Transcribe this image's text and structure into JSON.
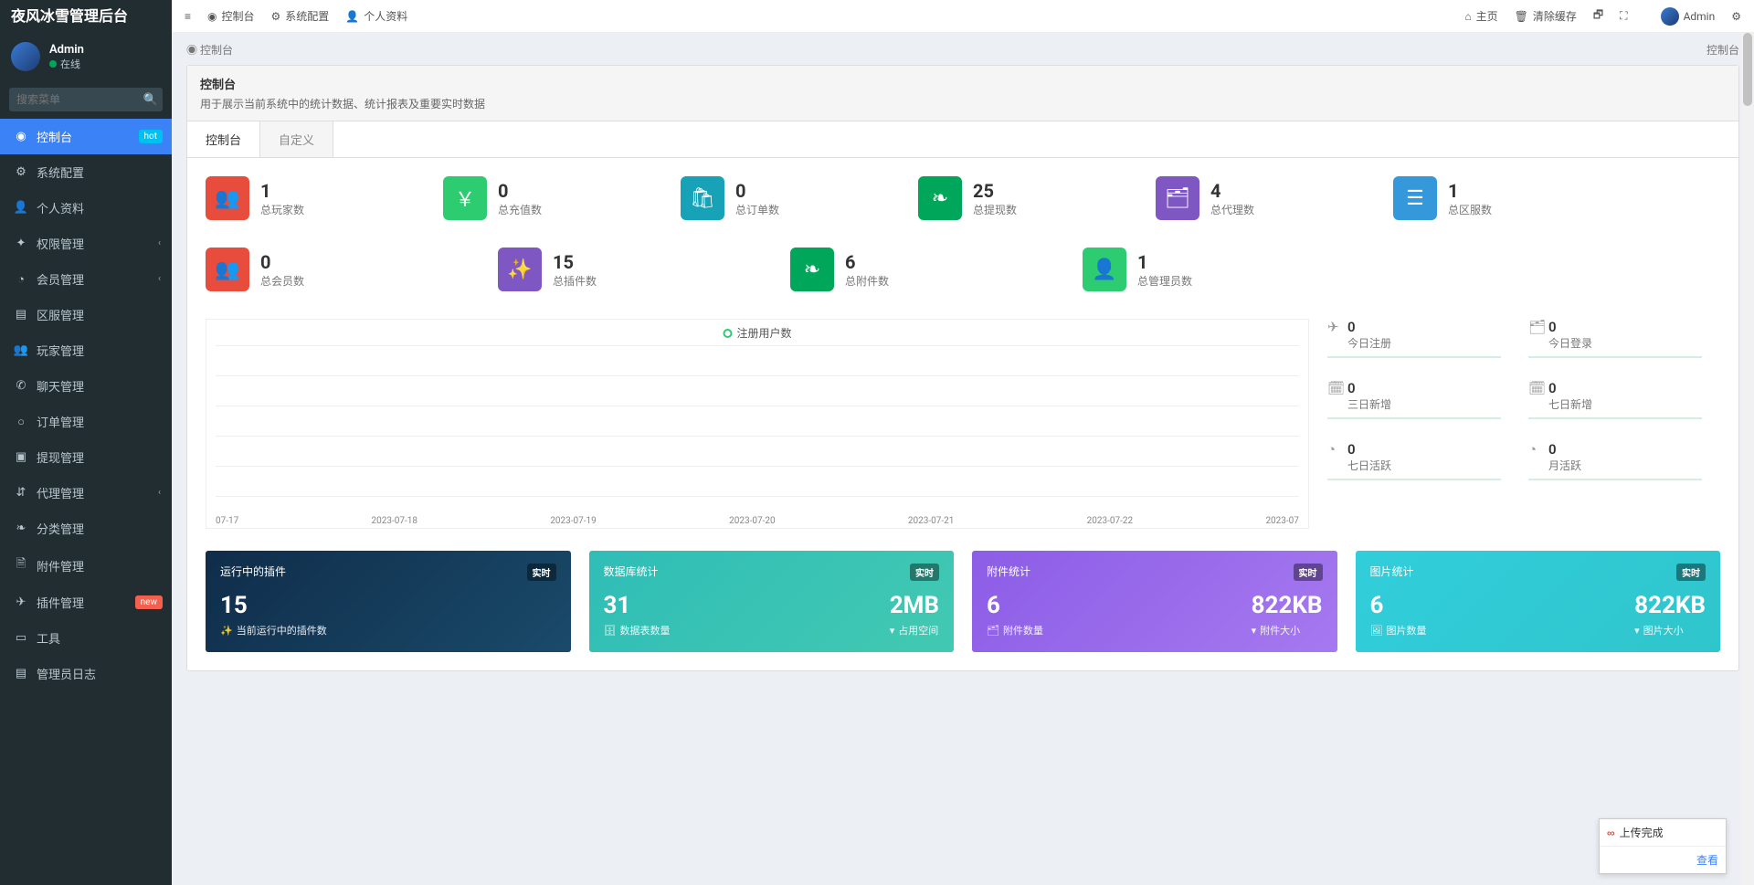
{
  "brand": "夜风冰雪管理后台",
  "user": {
    "name": "Admin",
    "status": "在线"
  },
  "search_placeholder": "搜索菜单",
  "sidebar": {
    "items": [
      {
        "label": "控制台",
        "icon": "◉",
        "badge": "hot",
        "active": true
      },
      {
        "label": "系统配置",
        "icon": "⚙"
      },
      {
        "label": "个人资料",
        "icon": "👤"
      },
      {
        "label": "权限管理",
        "icon": "✦",
        "chev": true
      },
      {
        "label": "会员管理",
        "icon": "◔",
        "chev": true
      },
      {
        "label": "区服管理",
        "icon": "▤"
      },
      {
        "label": "玩家管理",
        "icon": "👥"
      },
      {
        "label": "聊天管理",
        "icon": "✆"
      },
      {
        "label": "订单管理",
        "icon": "○"
      },
      {
        "label": "提现管理",
        "icon": "▣"
      },
      {
        "label": "代理管理",
        "icon": "⇵",
        "chev": true
      },
      {
        "label": "分类管理",
        "icon": "❧"
      },
      {
        "label": "附件管理",
        "icon": "🗎"
      },
      {
        "label": "插件管理",
        "icon": "✈",
        "badge": "new"
      },
      {
        "label": "工具",
        "icon": "▭"
      },
      {
        "label": "管理员日志",
        "icon": "▤"
      }
    ]
  },
  "topnav": {
    "left": [
      {
        "label": "控制台",
        "icon": "◉"
      },
      {
        "label": "系统配置",
        "icon": "⚙"
      },
      {
        "label": "个人资料",
        "icon": "👤"
      }
    ],
    "right": [
      {
        "label": "主页",
        "icon": "⌂"
      },
      {
        "label": "清除缓存",
        "icon": "🗑"
      },
      {
        "label": "",
        "icon": "🗗"
      },
      {
        "label": "",
        "icon": "⛶"
      }
    ],
    "user": "Admin",
    "gear": "⚙"
  },
  "breadcrumb": {
    "left": "控制台",
    "right": "控制台",
    "icon": "◉"
  },
  "panel": {
    "title": "控制台",
    "subtitle": "用于展示当前系统中的统计数据、统计报表及重要实时数据",
    "tabs": [
      "控制台",
      "自定义"
    ]
  },
  "stats1": [
    {
      "value": "1",
      "label": "总玩家数",
      "icon": "👥",
      "color": "bg-red"
    },
    {
      "value": "0",
      "label": "总充值数",
      "icon": "￥",
      "color": "bg-green"
    },
    {
      "value": "0",
      "label": "总订单数",
      "icon": "🛍",
      "color": "bg-teal"
    },
    {
      "value": "25",
      "label": "总提现数",
      "icon": "❧",
      "color": "bg-leaf"
    },
    {
      "value": "4",
      "label": "总代理数",
      "icon": "🗂",
      "color": "bg-purple"
    },
    {
      "value": "1",
      "label": "总区服数",
      "icon": "☰",
      "color": "bg-navy"
    }
  ],
  "stats2": [
    {
      "value": "0",
      "label": "总会员数",
      "icon": "👥",
      "color": "bg-red"
    },
    {
      "value": "15",
      "label": "总插件数",
      "icon": "✨",
      "color": "bg-purple"
    },
    {
      "value": "6",
      "label": "总附件数",
      "icon": "❧",
      "color": "bg-leaf"
    },
    {
      "value": "1",
      "label": "总管理员数",
      "icon": "👤",
      "color": "bg-green"
    }
  ],
  "chart": {
    "legend": "注册用户数",
    "x": [
      "07-17",
      "2023-07-18",
      "2023-07-19",
      "2023-07-20",
      "2023-07-21",
      "2023-07-22",
      "2023-07"
    ]
  },
  "side_metrics": [
    {
      "value": "0",
      "label": "今日注册",
      "icon": "✈"
    },
    {
      "value": "0",
      "label": "今日登录",
      "icon": "🗂"
    },
    {
      "value": "0",
      "label": "三日新增",
      "icon": "🗓"
    },
    {
      "value": "0",
      "label": "七日新增",
      "icon": "🗓"
    },
    {
      "value": "0",
      "label": "七日活跃",
      "icon": "◔"
    },
    {
      "value": "0",
      "label": "月活跃",
      "icon": "◔"
    }
  ],
  "cards": [
    {
      "title": "运行中的插件",
      "badge": "实时",
      "v1": "15",
      "l1": "当前运行中的插件数",
      "i1": "✨",
      "single": true
    },
    {
      "title": "数据库统计",
      "badge": "实时",
      "v1": "31",
      "l1": "数据表数量",
      "i1": "🗄",
      "v2": "2MB",
      "l2": "占用空间",
      "i2": "▾"
    },
    {
      "title": "附件统计",
      "badge": "实时",
      "v1": "6",
      "l1": "附件数量",
      "i1": "🗂",
      "v2": "822KB",
      "l2": "附件大小",
      "i2": "▾"
    },
    {
      "title": "图片统计",
      "badge": "实时",
      "v1": "6",
      "l1": "图片数量",
      "i1": "🖼",
      "v2": "822KB",
      "l2": "图片大小",
      "i2": "▾"
    }
  ],
  "toast": {
    "title": "上传完成",
    "link": "查看"
  }
}
